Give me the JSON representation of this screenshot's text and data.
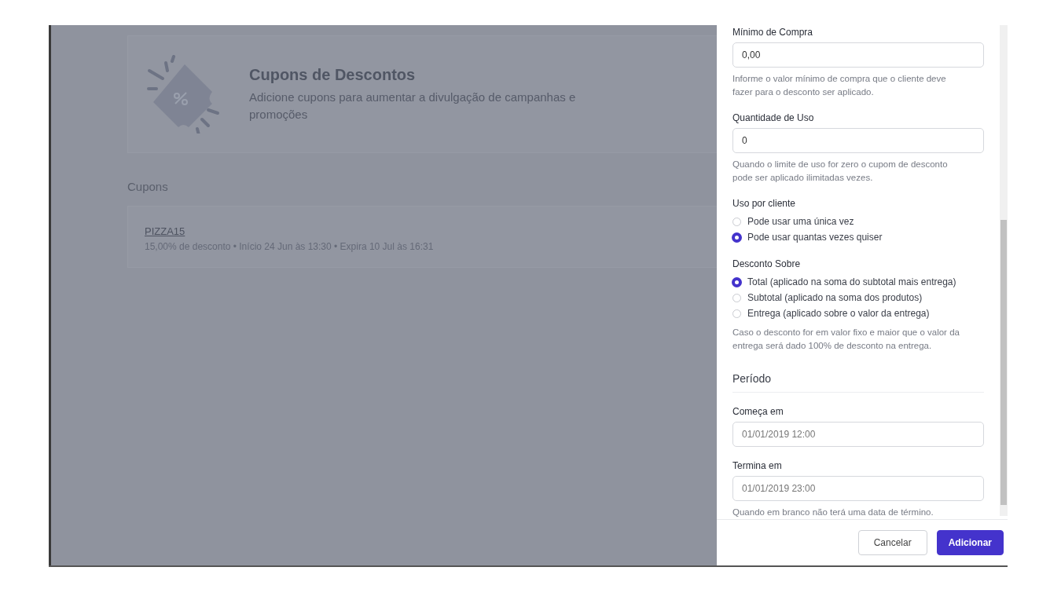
{
  "header": {
    "title": "Cupons de Descontos",
    "subtitle": "Adicione cupons para aumentar a divulgação de campanhas e promoções"
  },
  "coupons_title": "Cupons",
  "coupons": [
    {
      "code": "PIZZA15",
      "details": "15,00% de desconto • Início 24 Jun às 13:30 • Expira 10 Jul às 16:31"
    }
  ],
  "drawer": {
    "fields": [
      {
        "label": "Mínimo de Compra",
        "value": "0,00",
        "help": "Informe o valor mínimo de compra que o cliente deve fazer para o desconto ser aplicado."
      },
      {
        "label": "Quantidade de Uso",
        "value": "0",
        "help": "Quando o limite de uso for zero o cupom de desconto pode ser aplicado ilimitadas vezes."
      }
    ],
    "radio_groups": [
      {
        "label": "Uso por cliente",
        "options": [
          {
            "label": "Pode usar uma única vez",
            "selected": false
          },
          {
            "label": "Pode usar quantas vezes quiser",
            "selected": true
          }
        ]
      },
      {
        "label": "Desconto Sobre",
        "options": [
          {
            "label": "Total (aplicado na soma do subtotal mais entrega)",
            "selected": true
          },
          {
            "label": "Subtotal (aplicado na soma dos produtos)",
            "selected": false
          },
          {
            "label": "Entrega (aplicado sobre o valor da entrega)",
            "selected": false
          }
        ],
        "help": "Caso o desconto for em valor fixo e maior que o valor da entrega será dado 100% de desconto na entrega."
      }
    ],
    "period": {
      "title": "Período",
      "fields": [
        {
          "label": "Começa em",
          "placeholder": "01/01/2019 12:00"
        },
        {
          "label": "Termina em",
          "placeholder": "01/01/2019 23:00",
          "help": "Quando em branco não terá uma data de término."
        }
      ]
    },
    "buttons": [
      {
        "label": "Cancelar",
        "kind": "secondary"
      },
      {
        "label": "Adicionar",
        "kind": "primary"
      }
    ]
  }
}
